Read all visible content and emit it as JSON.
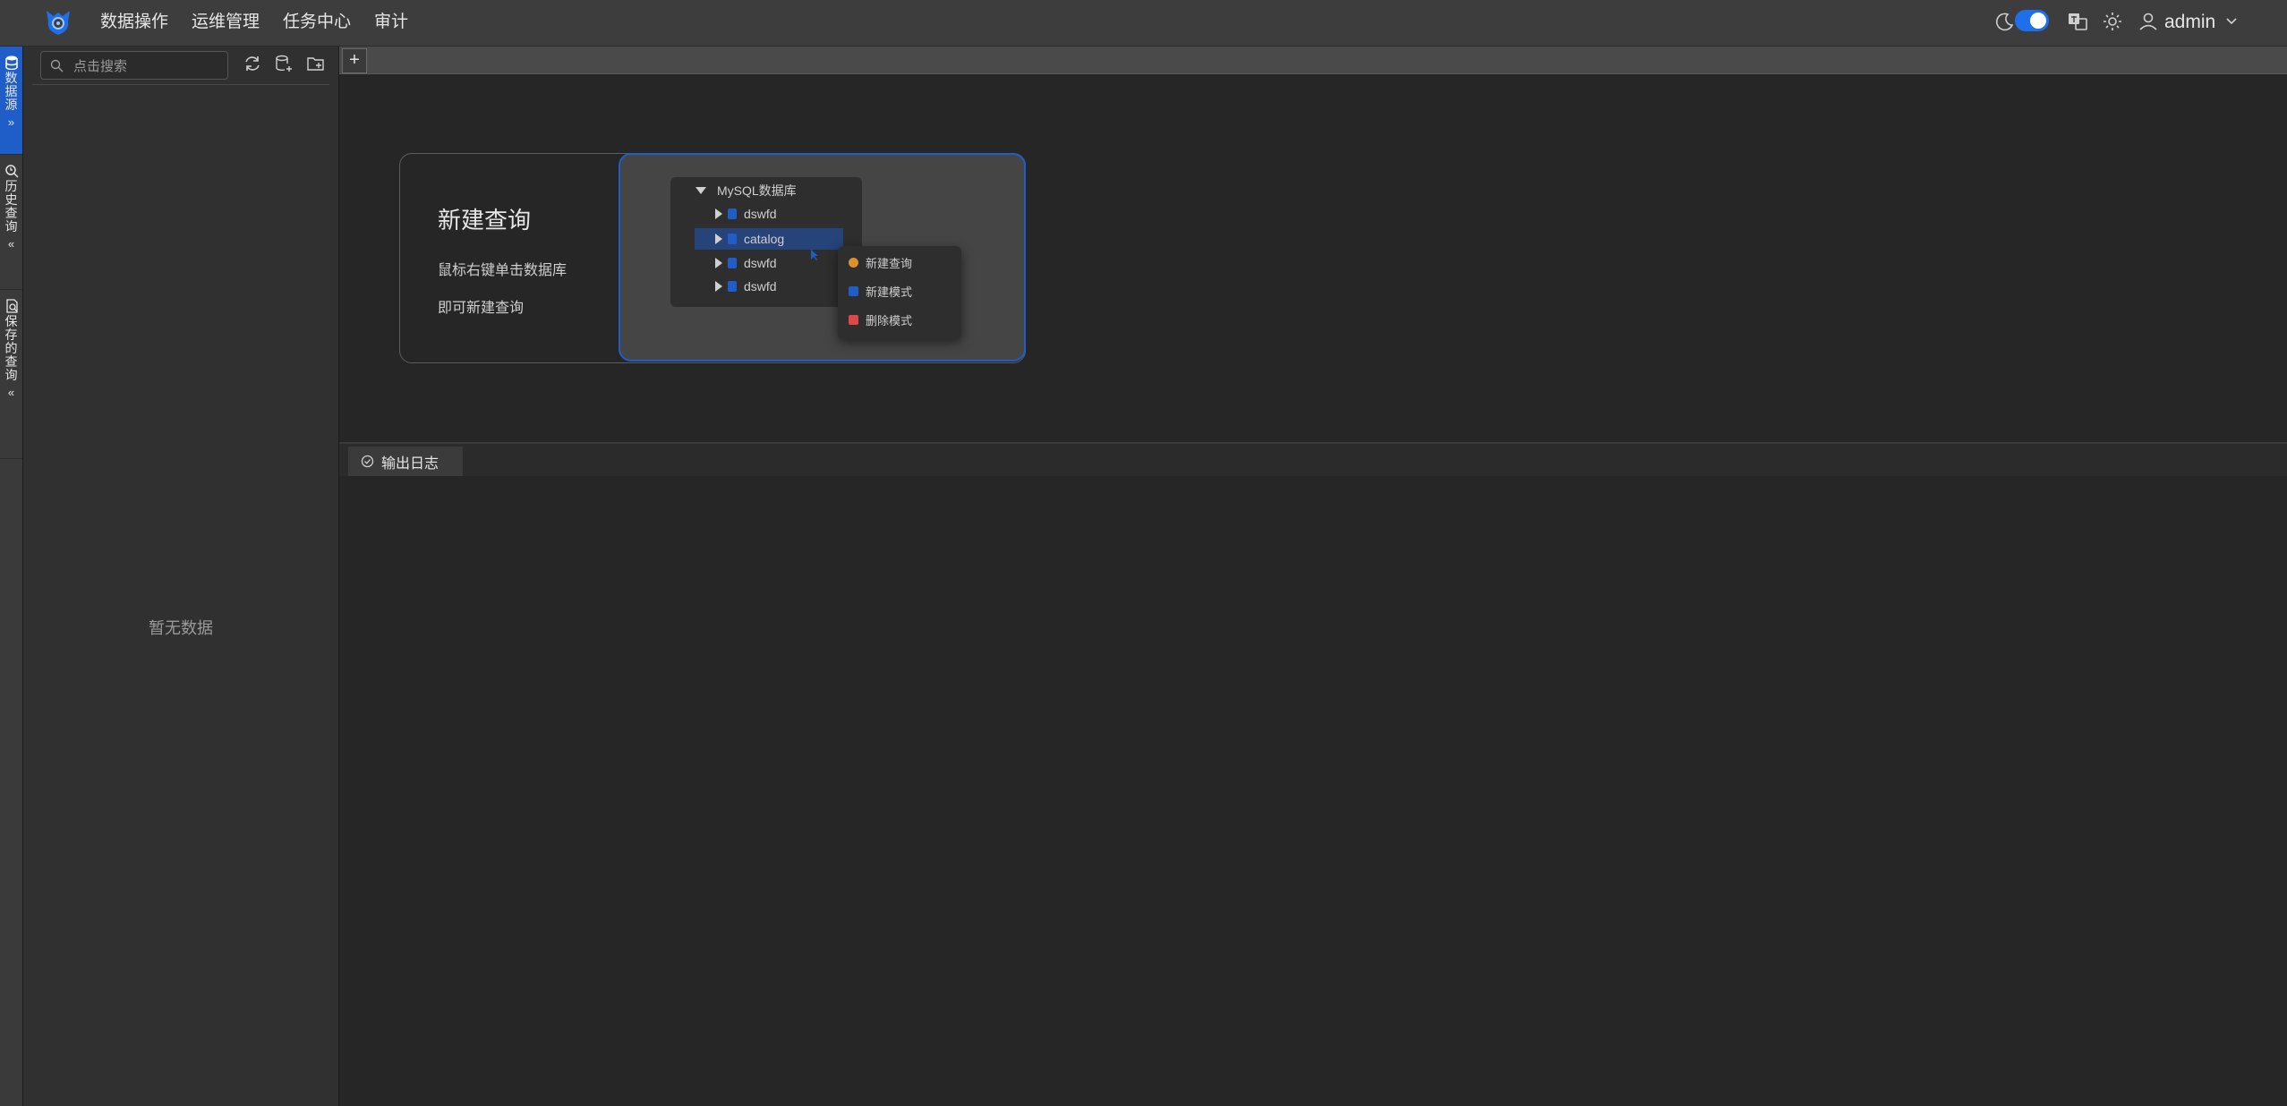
{
  "header": {
    "nav": [
      "数据操作",
      "运维管理",
      "任务中心",
      "审计"
    ],
    "user": "admin"
  },
  "rail": [
    {
      "label": "数据源",
      "icon": "database-icon",
      "chevron": "»",
      "active": true
    },
    {
      "label": "历史查询",
      "icon": "search-history-icon",
      "chevron": "«",
      "active": false
    },
    {
      "label": "保存的查询",
      "icon": "saved-query-icon",
      "chevron": "«",
      "active": false
    }
  ],
  "sidebar": {
    "search_placeholder": "点击搜索",
    "empty_text": "暂无数据"
  },
  "tabs": {
    "add_label": "+"
  },
  "hint": {
    "title": "新建查询",
    "line1": "鼠标右键单击数据库",
    "line2": "即可新建查询",
    "tree": {
      "root": "MySQL数据库",
      "items": [
        "dswfd",
        "catalog",
        "dswfd",
        "dswfd"
      ],
      "selected_index": 1
    },
    "context_menu": [
      "新建查询",
      "新建模式",
      "删除模式"
    ]
  },
  "output": {
    "tab_label": "输出日志"
  },
  "colors": {
    "accent": "#1f5ec9",
    "background": "#262626",
    "danger": "#e04848"
  }
}
